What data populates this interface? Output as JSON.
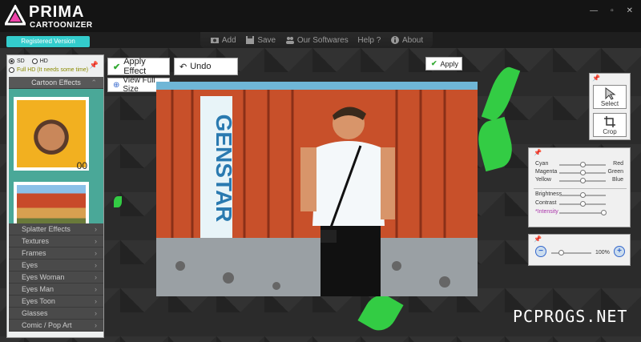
{
  "app": {
    "logo_line1": "PRIMA",
    "logo_line2": "CARTOONIZER",
    "registered": "Registered Version"
  },
  "toolbar": {
    "add": "Add",
    "save": "Save",
    "our_softwares": "Our Softwares",
    "help": "Help ?",
    "about": "About"
  },
  "quality": {
    "sd": "SD",
    "hd": "HD",
    "fullhd": "Full HD (It needs some time)",
    "selected": "SD"
  },
  "categories": {
    "header": "Cartoon Effects",
    "thumb_number": "00",
    "items": [
      "Splatter Effects",
      "Textures",
      "Frames",
      "Eyes",
      "Eyes Woman",
      "Eyes Man",
      "Eyes Toon",
      "Glasses",
      "Comic / Pop Art"
    ]
  },
  "buttons": {
    "apply_effect": "Apply Effect",
    "undo": "Undo",
    "view_full_size": "View Full Size",
    "apply": "Apply"
  },
  "tools": {
    "select": "Select",
    "crop": "Crop"
  },
  "color": {
    "cyan": "Cyan",
    "red": "Red",
    "magenta": "Magenta",
    "green": "Green",
    "yellow": "Yellow",
    "blue": "Blue",
    "brightness": "Brightness",
    "contrast": "Contrast",
    "intensity": "*Intensity",
    "levels": {
      "cyan_red": 0.5,
      "magenta_green": 0.5,
      "yellow_blue": 0.5,
      "brightness": 0.5,
      "contrast": 0.5,
      "intensity": 0.95
    }
  },
  "zoom": {
    "percent": "100%",
    "level": 0.25
  },
  "photo": {
    "container_text": "GENSTAR"
  },
  "watermark": "PCPROGS.NET",
  "colors": {
    "accent": "#33cccc",
    "leaf": "#33cc44"
  }
}
